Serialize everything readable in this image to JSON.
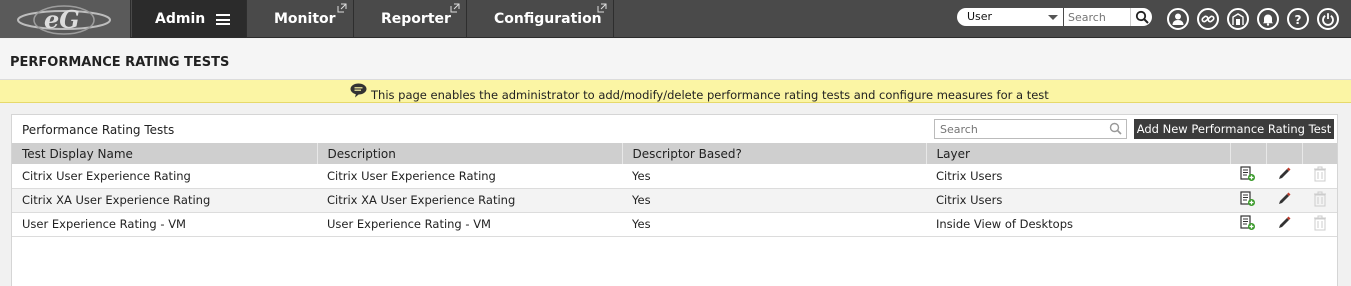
{
  "nav": {
    "admin": "Admin",
    "monitor": "Monitor",
    "reporter": "Reporter",
    "configuration": "Configuration"
  },
  "top": {
    "user_select": "User",
    "search_placeholder": "Search",
    "icons": [
      "user-icon",
      "link-icon",
      "building-icon",
      "bell-icon",
      "help-icon",
      "power-icon"
    ]
  },
  "page": {
    "title": "PERFORMANCE RATING TESTS",
    "info": "This page enables the administrator to add/modify/delete performance rating tests and configure measures for a test"
  },
  "panel": {
    "title": "Performance Rating Tests",
    "search_placeholder": "Search",
    "add_button": "Add New Performance Rating Test"
  },
  "table": {
    "headers": [
      "Test Display Name",
      "Description",
      "Descriptor Based?",
      "Layer"
    ],
    "rows": [
      {
        "name": "Citrix User Experience Rating",
        "description": "Citrix User Experience Rating",
        "descriptor": "Yes",
        "layer": "Citrix Users"
      },
      {
        "name": "Citrix XA User Experience Rating",
        "description": "Citrix XA User Experience Rating",
        "descriptor": "Yes",
        "layer": "Citrix Users"
      },
      {
        "name": "User Experience Rating - VM",
        "description": "User Experience Rating - VM",
        "descriptor": "Yes",
        "layer": "Inside View of Desktops"
      }
    ]
  },
  "colors": {
    "nav_bg": "#4a4a4a",
    "nav_active": "#2b2b2b",
    "info_bg": "#fbf5a4",
    "header_bg": "#cfcfcf",
    "add_icon_green": "#3a9a2a",
    "edit_icon_red": "#c0392b"
  }
}
